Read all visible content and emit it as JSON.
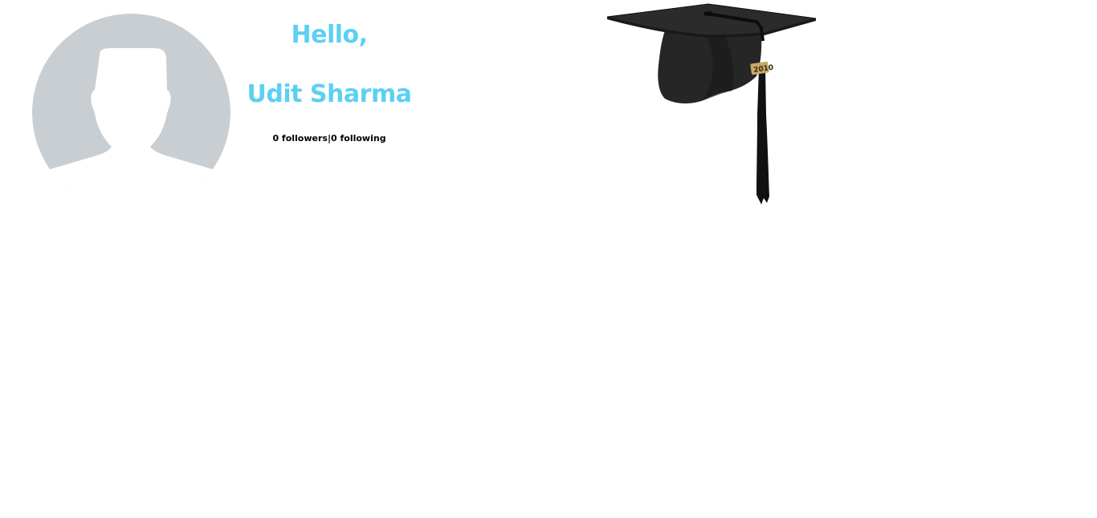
{
  "profile": {
    "greeting": "Hello,",
    "name": "Udit Sharma",
    "followers_label": "0 followers",
    "separator": "|",
    "following_label": "0 following"
  },
  "icons": {
    "avatar": "default-user-avatar-icon",
    "graduation": "graduation-cap-icon",
    "tassel_charm_text": "2010"
  },
  "colors": {
    "accent": "#5bd0f3",
    "avatar_bg": "#c9ced3",
    "avatar_figure": "#ffffff",
    "cap": "#1e1e1e",
    "text": "#000000"
  }
}
